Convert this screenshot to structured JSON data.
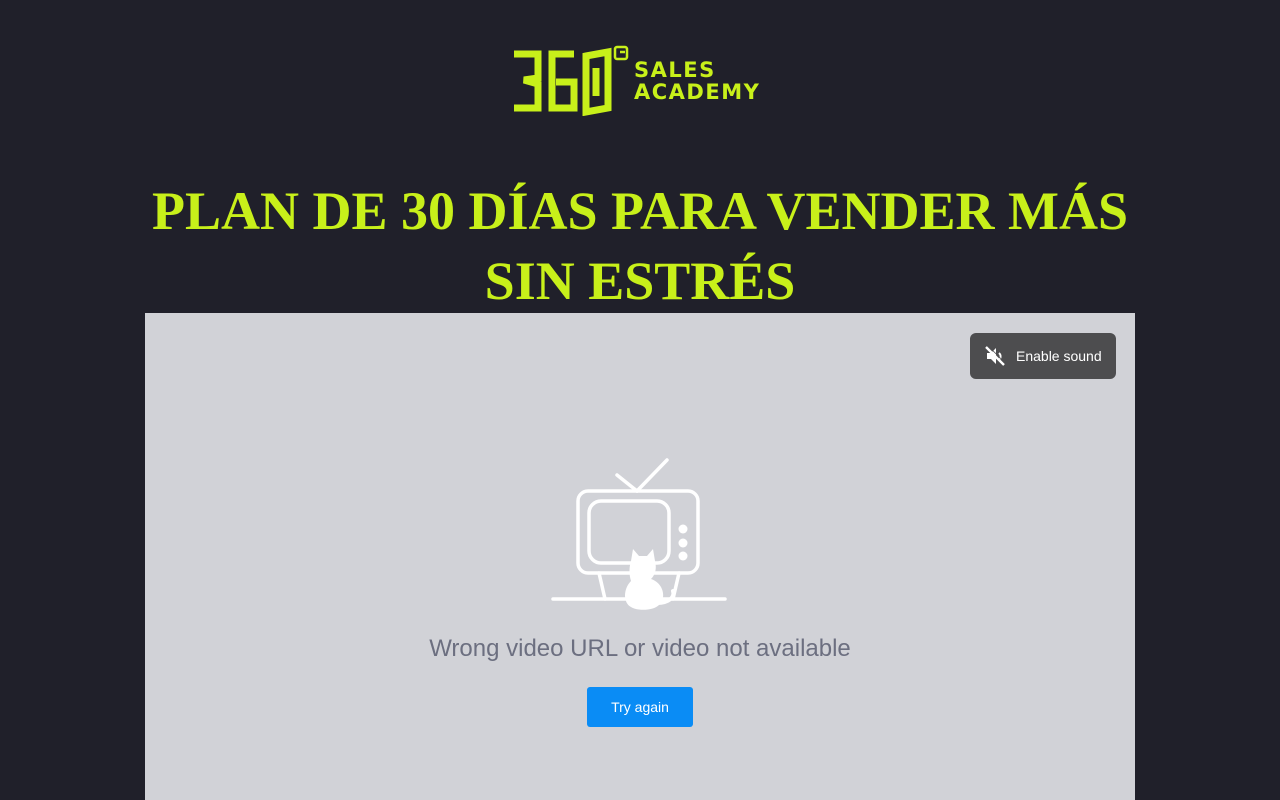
{
  "logo": {
    "mark_text": "360",
    "line1": "SALES",
    "line2": "ACADEMY"
  },
  "headline": "PLAN DE 30 DÍAS PARA VENDER MÁS SIN ESTRÉS",
  "player": {
    "sound_button_label": "Enable sound",
    "error_message": "Wrong video URL or video not available",
    "retry_label": "Try again",
    "mute_icon": "speaker-muted-icon",
    "placeholder_icon": "tv-cat-icon"
  },
  "colors": {
    "background": "#20202a",
    "brand_accent": "#c8f01a",
    "player_background": "#d1d2d7",
    "retry_button": "#0a8cf5",
    "sound_button": "#4d4d4f"
  }
}
